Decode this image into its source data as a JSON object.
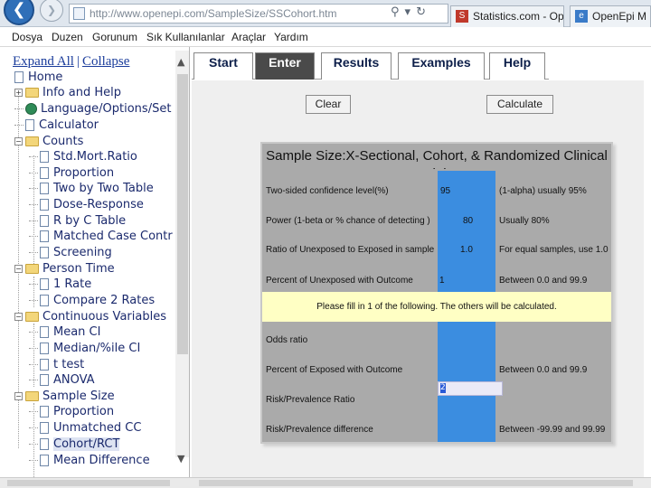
{
  "browser": {
    "url": "http://www.openepi.com/SampleSize/SSCohort.htm",
    "tabs": [
      "Statistics.com - Op...",
      "OpenEpi M"
    ]
  },
  "menu": [
    "Dosya",
    "Duzen",
    "Gorunum",
    "Sık Kullanılanlar",
    "Araçlar",
    "Yardım"
  ],
  "tree": {
    "expand_all": "Expand All",
    "separator": "|",
    "collapse": "Collapse",
    "items": [
      "Home",
      "Info and Help",
      "Language/Options/Set",
      "Calculator",
      "Counts",
      "Std.Mort.Ratio",
      "Proportion",
      "Two by Two Table",
      "Dose-Response",
      "R by C Table",
      "Matched Case Contr",
      "Screening",
      "Person Time",
      "1 Rate",
      "Compare 2 Rates",
      "Continuous Variables",
      "Mean CI",
      "Median/%ile CI",
      "t test",
      "ANOVA",
      "Sample Size",
      "Proportion",
      "Unmatched CC",
      "Cohort/RCT",
      "Mean Difference"
    ]
  },
  "navtabs": [
    "Start",
    "Enter",
    "Results",
    "Examples",
    "Help"
  ],
  "buttons": {
    "clear": "Clear",
    "calculate": "Calculate"
  },
  "calc": {
    "title": "Sample Size:X-Sectional, Cohort, & Randomized Clinical Trials",
    "rows": [
      {
        "label": "Two-sided confidence level(%)",
        "value": "95",
        "hint": "(1-alpha) usually 95%"
      },
      {
        "label": "Power (1-beta or % chance of detecting )",
        "value": "80",
        "hint": "Usually 80%"
      },
      {
        "label": "Ratio of Unexposed to Exposed in sample",
        "value": "1.0",
        "hint": "For equal samples, use 1.0"
      },
      {
        "label": "Percent of Unexposed with Outcome",
        "value": "1",
        "hint": "Between 0.0 and 99.9"
      }
    ],
    "note": "Please fill in 1 of the following. The others will be calculated.",
    "rows2": [
      {
        "label": "Odds ratio",
        "value": "",
        "hint": ""
      },
      {
        "label": "Percent of Exposed with Outcome",
        "value": "",
        "hint": "Between 0.0 and 99.9"
      },
      {
        "label": "Risk/Prevalence Ratio",
        "value": "2",
        "hint": ""
      },
      {
        "label": "Risk/Prevalence difference",
        "value": "",
        "hint": "Between -99.99 and 99.99"
      }
    ]
  }
}
